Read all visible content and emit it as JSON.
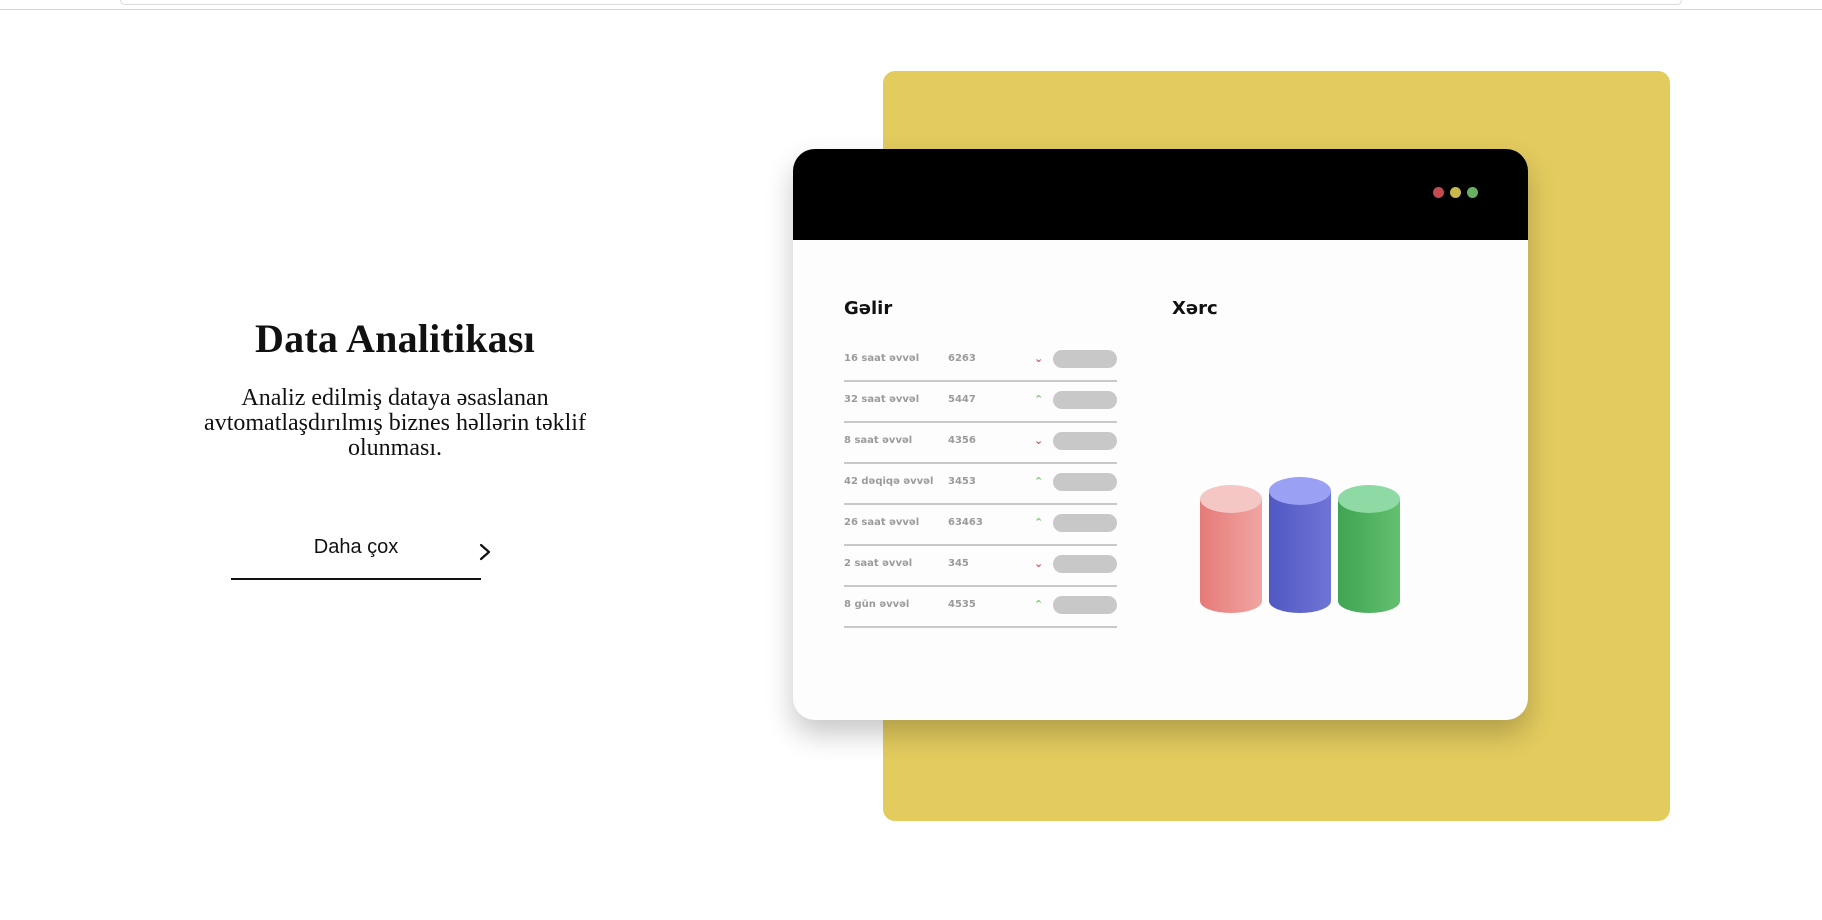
{
  "hero": {
    "title": "Data Analitikası",
    "description": "Analiz edilmiş dataya əsaslanan avtomatlaşdırılmış biznes həllərin təklif olunması.",
    "cta_label": "Daha çox"
  },
  "illustration": {
    "accent_color": "#e3cb5e",
    "window_dots": [
      "#c44a4f",
      "#c9b84c",
      "#68b160"
    ],
    "income": {
      "title": "Gəlir",
      "rows": [
        {
          "time": "16 saat əvvəl",
          "value": "6263",
          "trend": "down"
        },
        {
          "time": "32 saat əvvəl",
          "value": "5447",
          "trend": "up"
        },
        {
          "time": "8 saat əvvəl",
          "value": "4356",
          "trend": "down"
        },
        {
          "time": "42 dəqiqə əvvəl",
          "value": "3453",
          "trend": "up"
        },
        {
          "time": "26 saat əvvəl",
          "value": "63463",
          "trend": "up"
        },
        {
          "time": "2 saat əvvəl",
          "value": "345",
          "trend": "down"
        },
        {
          "time": "8 gün əvvəl",
          "value": "4535",
          "trend": "up"
        }
      ]
    },
    "expense": {
      "title": "Xərc",
      "cylinder_colors": [
        "#ee8f8d",
        "#5d63cc",
        "#4daf5e"
      ]
    }
  }
}
